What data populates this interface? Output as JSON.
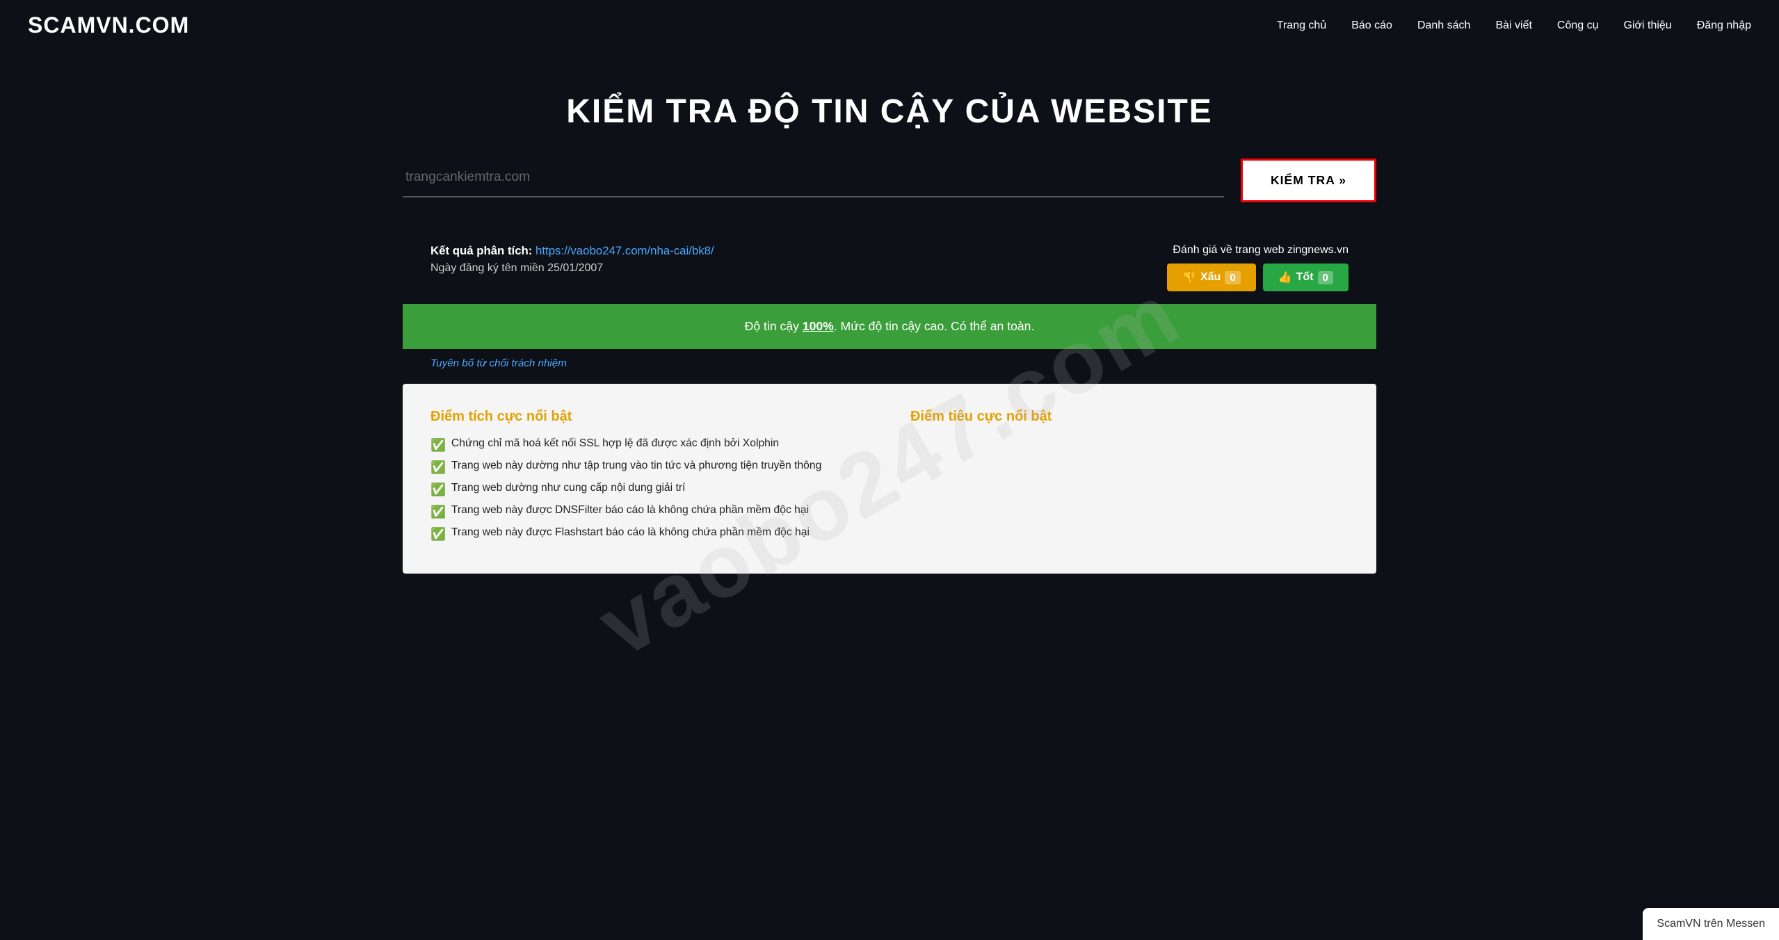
{
  "site": {
    "logo": "SCAMVN.COM"
  },
  "nav": {
    "items": [
      {
        "label": "Trang chủ",
        "href": "#"
      },
      {
        "label": "Báo cáo",
        "href": "#"
      },
      {
        "label": "Danh sách",
        "href": "#"
      },
      {
        "label": "Bài viết",
        "href": "#"
      },
      {
        "label": "Công cụ",
        "href": "#"
      },
      {
        "label": "Giới thiệu",
        "href": "#"
      },
      {
        "label": "Đăng nhập",
        "href": "#"
      }
    ]
  },
  "hero": {
    "title": "KIỂM TRA ĐỘ TIN CẬY CỦA WEBSITE",
    "search_placeholder": "trangcankiemtra.com",
    "search_button": "KIỂM TRA »"
  },
  "results": {
    "analysis_label": "Kết quả phân tích:",
    "analysis_url": "https://vaobo247.com/nha-cai/bk8/",
    "date_label": "Ngày đăng ký tên miền 25/01/2007",
    "rating_label": "Đánh giá về trang web zingnews.vn",
    "bad_button": "👎 Xấu",
    "bad_count": "0",
    "good_button": "👍 Tốt",
    "good_count": "0"
  },
  "trust_bar": {
    "text_before": "Độ tin cậy ",
    "percent": "100%",
    "text_after": ". Mức độ tin cậy cao. Có thể an toàn."
  },
  "disclaimer": {
    "text": "Tuyên bố từ chối trách nhiệm"
  },
  "analysis": {
    "positive_title": "Điểm tích cực nổi bật",
    "negative_title": "Điểm tiêu cực nổi bật",
    "positive_items": [
      "Chứng chỉ mã hoá kết nối SSL hợp lệ đã được xác định bởi Xolphin",
      "Trang web này dường như tập trung vào tin tức và phương tiện truyền thông",
      "Trang web dường như cung cấp nội dung giải trí",
      "Trang web này được DNSFilter báo cáo là không chứa phần mềm độc hại",
      "Trang web này được Flashstart báo cáo là không chứa phần mềm độc hại"
    ],
    "negative_items": []
  },
  "watermark": {
    "text": "vaobo247.com"
  },
  "messenger": {
    "label": "ScamVN trên Messen"
  }
}
